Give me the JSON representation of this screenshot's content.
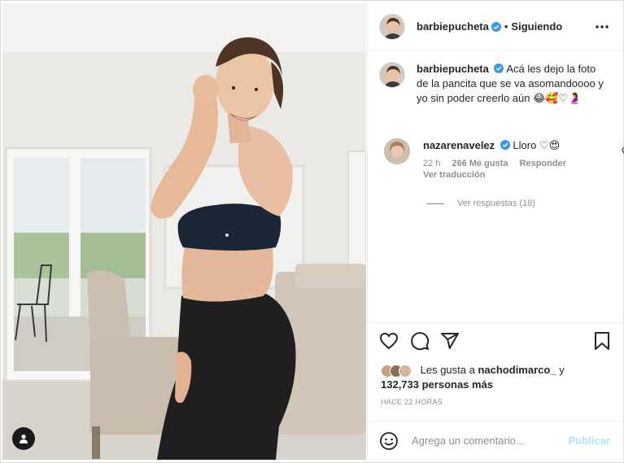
{
  "post": {
    "username": "barbiepucheta",
    "separator": "•",
    "follow_label": "Siguiendo",
    "caption": "Acá les dejo la foto de la pancita que se va asomandoooo y yo sin poder creerlo aún 😂🥰♡🤰",
    "caption_emoji_note": ""
  },
  "comment": {
    "username": "nazarenavelez",
    "text": "Lloro ♡😍",
    "time": "22 h",
    "likes": "266 Me gusta",
    "reply_label": "Responder",
    "translate_label": "Ver traducción",
    "view_replies": "Ver respuestas (18)"
  },
  "likes": {
    "prefix": "Les gusta a",
    "user": "nachodimarco_",
    "connector": "y",
    "count_text": "132,733 personas más"
  },
  "timestamp": "HACE 22 HORAS",
  "add_comment": {
    "placeholder": "Agrega un comentario...",
    "publish_label": "Publicar"
  },
  "colors": {
    "verified": "#3897f0",
    "publish_disabled": "#b2dffc",
    "secondary_text": "#8e8e8e",
    "border": "#efefef"
  },
  "icons": {
    "header_more": "more-icon",
    "like": "heart-icon",
    "comment": "comment-icon",
    "share": "share-icon",
    "save": "bookmark-icon",
    "emoji": "emoji-icon",
    "user_tag": "user-tag-icon"
  }
}
